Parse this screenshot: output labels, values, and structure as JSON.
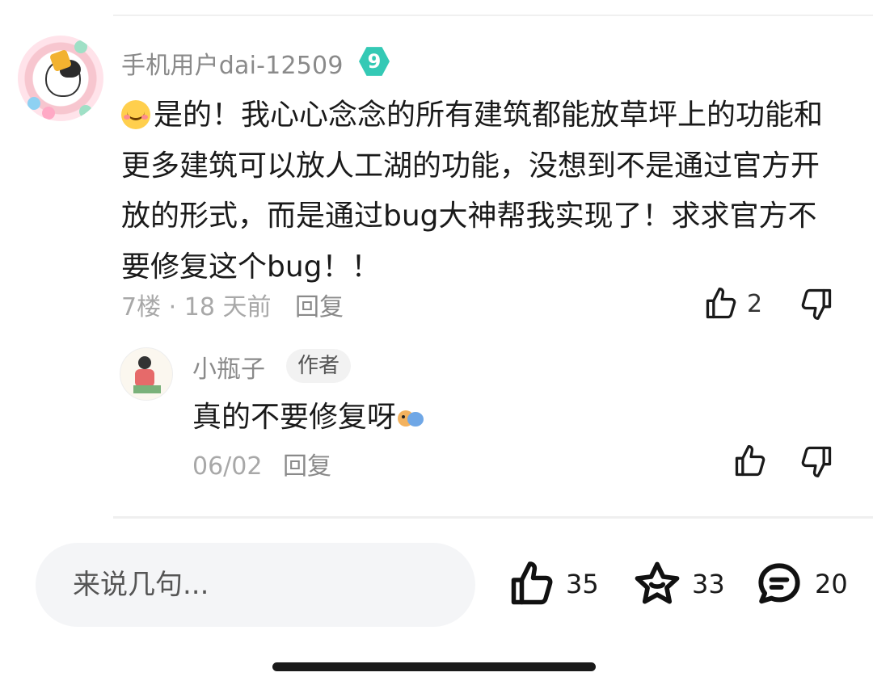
{
  "comment": {
    "username": "手机用户dai-12509",
    "level": "9",
    "text": "是的！我心心念念的所有建筑都能放草坪上的功能和更多建筑可以放人工湖的功能，没想到不是通过官方开放的形式，而是通过bug大神帮我实现了！求求官方不要修复这个bug！！",
    "floor": "7楼",
    "separator": "·",
    "time": "18 天前",
    "reply_label": "回复",
    "like_count": "2"
  },
  "reply": {
    "username": "小瓶子",
    "author_tag": "作者",
    "text": "真的不要修复呀",
    "date": "06/02",
    "reply_label": "回复"
  },
  "bottom_bar": {
    "input_placeholder": "来说几句...",
    "like_count": "35",
    "favorite_count": "33",
    "comment_count": "20"
  },
  "icons": [
    "thumb-up-icon",
    "thumb-down-icon",
    "star-icon",
    "comment-bubble-icon",
    "level-badge-icon",
    "smile-emoji-icon",
    "bird-emoji-icon"
  ],
  "colors": {
    "level_badge": "#34c9b5",
    "muted_text": "#8a8a8a",
    "input_bg": "#f4f5f7"
  }
}
